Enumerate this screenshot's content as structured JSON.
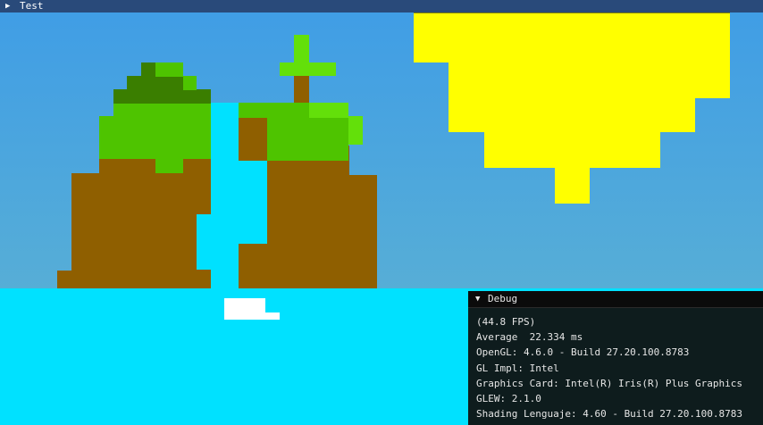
{
  "scene": {
    "colors": {
      "sky_top": "#3f9de6",
      "sky_bottom": "#57aed6",
      "water": "#00e1ff",
      "dirt": "#8f5f00",
      "grass": "#4ec400",
      "grass_light": "#63e00a",
      "grass_dark": "#3a7e00",
      "trunk": "#8f5f00",
      "foam": "#ffffff",
      "sun": "#ffff00",
      "sun_shade": "#808000"
    }
  },
  "title_window": {
    "title": "Test",
    "arrow_icon": "triangle-right-icon"
  },
  "debug_window": {
    "title": "Debug",
    "arrow_icon": "triangle-down-icon",
    "lines": [
      "(44.8 FPS)",
      "Average  22.334 ms",
      "OpenGL: 4.6.0 - Build 27.20.100.8783",
      "GL Impl: Intel",
      "Graphics Card: Intel(R) Iris(R) Plus Graphics",
      "GLEW: 2.1.0",
      "Shading Lenguaje: 4.60 - Build 27.20.100.8783"
    ]
  }
}
